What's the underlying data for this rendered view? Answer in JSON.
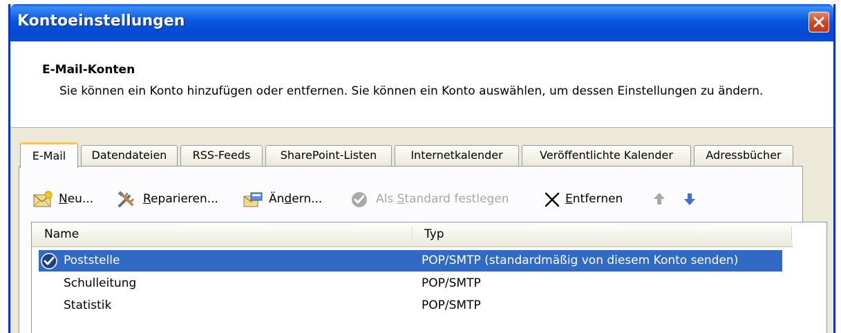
{
  "window": {
    "title": "Kontoeinstellungen"
  },
  "header": {
    "title": "E-Mail-Konten",
    "description": "Sie können ein Konto hinzufügen oder entfernen. Sie können ein Konto auswählen, um dessen Einstellungen zu ändern."
  },
  "tabs": [
    {
      "label": "E-Mail",
      "active": true
    },
    {
      "label": "Datendateien"
    },
    {
      "label": "RSS-Feeds"
    },
    {
      "label": "SharePoint-Listen"
    },
    {
      "label": "Internetkalender"
    },
    {
      "label": "Veröffentlichte Kalender"
    },
    {
      "label": "Adressbücher"
    }
  ],
  "toolbar": {
    "new_pre": "",
    "new_acc": "N",
    "new_post": "eu...",
    "repair_pre": "",
    "repair_acc": "R",
    "repair_post": "eparieren...",
    "change_pre": "Än",
    "change_acc": "d",
    "change_post": "ern...",
    "default_pre": "Als ",
    "default_acc": "S",
    "default_post": "tandard festlegen",
    "remove_pre": "",
    "remove_acc": "E",
    "remove_post": "ntfernen",
    "icons": [
      "mail-new-icon",
      "repair-tools-icon",
      "change-icon",
      "default-check-icon",
      "remove-x-icon",
      "arrow-up-icon",
      "arrow-down-icon"
    ]
  },
  "list": {
    "columns": {
      "name": "Name",
      "type": "Typ"
    },
    "rows": [
      {
        "name": "Poststelle",
        "type": "POP/SMTP (standardmäßig von diesem Konto senden)",
        "selected": true,
        "default": true
      },
      {
        "name": "Schulleitung",
        "type": "POP/SMTP"
      },
      {
        "name": "Statistik",
        "type": "POP/SMTP"
      }
    ]
  },
  "colors": {
    "title_bar": "#0054e3",
    "selection": "#316ac5",
    "close_button": "#d0411e",
    "tab_highlight": "#ffc83c"
  }
}
